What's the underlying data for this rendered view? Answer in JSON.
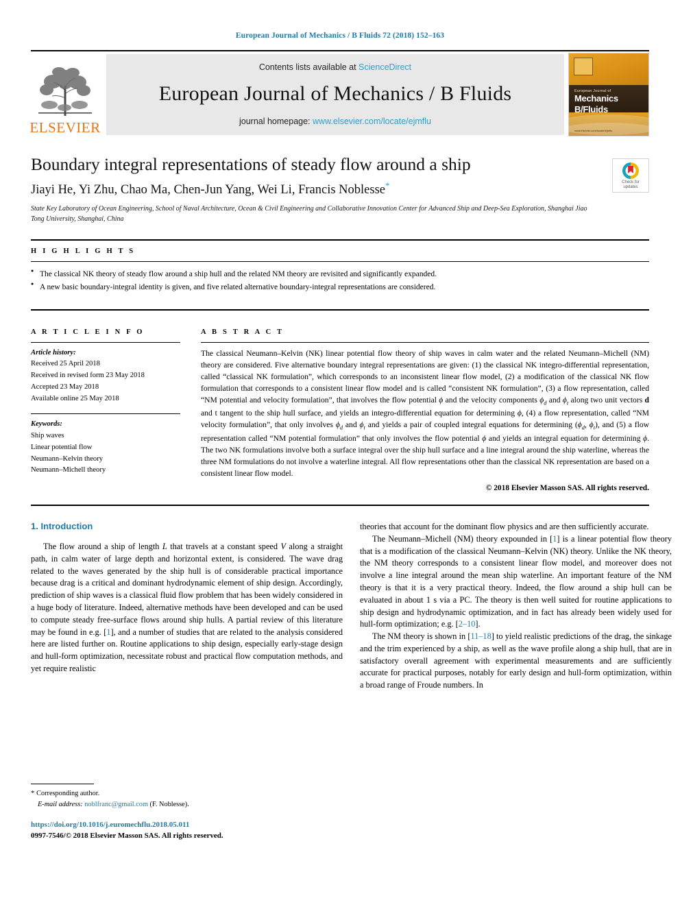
{
  "running_head": "European Journal of Mechanics / B Fluids 72 (2018) 152–163",
  "masthead": {
    "contents_prefix": "Contents lists available at ",
    "contents_link": "ScienceDirect",
    "journal_title": "European Journal of Mechanics / B Fluids",
    "homepage_prefix": "journal homepage: ",
    "homepage_link": "www.elsevier.com/locate/ejmflu",
    "publisher_wordmark": "ELSEVIER",
    "cover": {
      "line1": "European Journal of",
      "line2": "Mechanics",
      "line3": "B/Fluids",
      "url": "www.elsevier.com/locate/ejmflu"
    }
  },
  "article": {
    "title": "Boundary integral representations of steady flow around a ship",
    "authors": "Jiayi He, Yi Zhu, Chao Ma, Chen-Jun Yang, Wei Li, Francis Noblesse",
    "author_star": "*",
    "affiliation": "State Key Laboratory of Ocean Engineering, School of Naval Architecture, Ocean & Civil Engineering and Collaborative Innovation Center for Advanced Ship and Deep-Sea Exploration, Shanghai Jiao Tong University, Shanghai, China",
    "crossmark_line1": "Check for",
    "crossmark_line2": "updates"
  },
  "highlights": {
    "heading": "H I G H L I G H T S",
    "items": [
      "The classical NK theory of steady flow around a ship hull and the related NM theory are revisited and significantly expanded.",
      "A new basic boundary-integral identity is given, and five related alternative boundary-integral representations are considered."
    ]
  },
  "article_info": {
    "heading": "A R T I C L E   I N F O",
    "history_label": "Article history:",
    "history": [
      "Received 25 April 2018",
      "Received in revised form 23 May 2018",
      "Accepted 23 May 2018",
      "Available online 25 May 2018"
    ],
    "keywords_label": "Keywords:",
    "keywords": [
      "Ship waves",
      "Linear potential flow",
      "Neumann–Kelvin theory",
      "Neumann–Michell theory"
    ]
  },
  "abstract": {
    "heading": "A B S T R A C T",
    "copyright": "© 2018 Elsevier Masson SAS. All rights reserved.",
    "part1": "The classical Neumann–Kelvin (NK) linear potential flow theory of ship waves in calm water and the related Neumann–Michell (NM) theory are considered. Five alternative boundary integral representations are given: (1) the classical NK integro-differential representation, called “classical NK formulation”, which corresponds to an inconsistent linear flow model, (2) a modification of the classical NK flow formulation that corresponds to a consistent linear flow model and is called “consistent NK formulation”, (3) a flow representation, called “NM potential and velocity formulation”, that involves the flow potential ",
    "part2": " and the velocity components ",
    "part3": " and ",
    "part4": " along two unit vectors ",
    "part5": " and t tangent to the ship hull surface, and yields an integro-differential equation for determining ",
    "part6": ", (4) a flow representation, called “NM velocity formulation”, that only involves ",
    "part7": " and ",
    "part8": " and yields a pair of coupled integral equations for determining (",
    "part9": ", ",
    "part10": "), and (5) a flow representation called “NM potential formulation” that only involves the flow potential ",
    "part11": " and yields an integral equation for determining ",
    "part12": ". The two NK formulations involve both a surface integral over the ship hull surface and a line integral around the ship waterline, whereas the three NM formulations do not involve a waterline integral. All flow representations other than the classical NK representation are based on a consistent linear flow model.",
    "sym_phi": "ϕ",
    "sym_phi_d": "ϕ",
    "sym_phi_d_sub": "d",
    "sym_phi_t": "ϕ",
    "sym_phi_t_sub": "t",
    "sym_d_vector": "d"
  },
  "body": {
    "section_number": "1.",
    "section_title": "Introduction",
    "left_p1_a": "The flow around a ship of length ",
    "left_p1_L": "L",
    "left_p1_b": " that travels at a constant speed ",
    "left_p1_V": "V",
    "left_p1_c": " along a straight path, in calm water of large depth and horizontal extent, is considered. The wave drag related to the waves generated by the ship hull is of considerable practical importance because drag is a critical and dominant hydrodynamic element of ship design. Accordingly, prediction of ship waves is a classical fluid flow problem that has been widely considered in a huge body of literature. Indeed, alternative methods have been developed and can be used to compute steady free-surface flows around ship hulls. A partial review of this literature may be found in e.g. [",
    "left_p1_cite1": "1",
    "left_p1_d": "], and a number of studies that are related to the analysis considered here are listed further on. Routine applications to ship design, especially early-stage design and hull-form optimization, necessitate robust and practical flow computation methods, and yet require realistic",
    "right_p1": "theories that account for the dominant flow physics and are then sufficiently accurate.",
    "right_p2_a": "The Neumann–Michell (NM) theory expounded in [",
    "right_p2_cite1": "1",
    "right_p2_b": "] is a linear potential flow theory that is a modification of the classical Neumann–Kelvin (NK) theory. Unlike the NK theory, the NM theory corresponds to a consistent linear flow model, and moreover does not involve a line integral around the mean ship waterline. An important feature of the NM theory is that it is a very practical theory. Indeed, the flow around a ship hull can be evaluated in about 1 s via a PC. The theory is then well suited for routine applications to ship design and hydrodynamic optimization, and in fact has already been widely used for hull-form optimization; e.g. [",
    "right_p2_cite2": "2–10",
    "right_p2_c": "].",
    "right_p3_a": "The NM theory is shown in [",
    "right_p3_cite1": "11–18",
    "right_p3_b": "] to yield realistic predictions of the drag, the sinkage and the trim experienced by a ship, as well as the wave profile along a ship hull, that are in satisfactory overall agreement with experimental measurements and are sufficiently accurate for practical purposes, notably for early design and hull-form optimization, within a broad range of Froude numbers. In"
  },
  "footer": {
    "corresponding_star": "*",
    "corresponding_label": " Corresponding author.",
    "email_label": "E-mail address:",
    "email": "noblfranc@gmail.com",
    "email_suffix": " (F. Noblesse).",
    "doi": "https://doi.org/10.1016/j.euromechflu.2018.05.011",
    "issn_line": "0997-7546/© 2018 Elsevier Masson SAS. All rights reserved."
  },
  "colors": {
    "link_blue": "#1d7ba8",
    "science_direct_blue": "#2f9fd0",
    "elsevier_orange": "#e87511"
  }
}
